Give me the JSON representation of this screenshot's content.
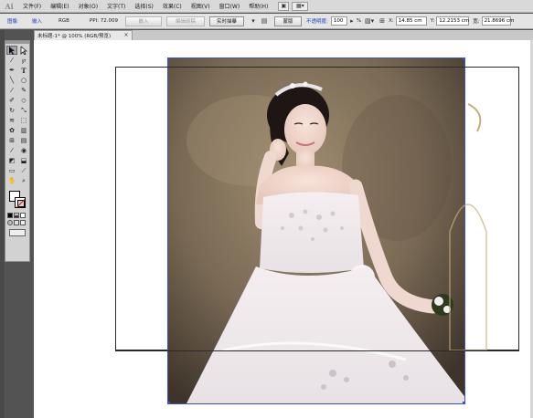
{
  "app": {
    "logo": "Ai"
  },
  "menu": {
    "items": [
      "文件(F)",
      "编辑(E)",
      "对象(O)",
      "文字(T)",
      "选择(S)",
      "效果(C)",
      "视图(V)",
      "窗口(W)",
      "帮助(H)"
    ]
  },
  "control_bar": {
    "image_label": "图像",
    "embed_link": "嵌入",
    "color_mode": "RGB",
    "ppi": "PPI: 72.009",
    "embed_button": "嵌入",
    "edit_original_button": "编辑原稿",
    "live_trace_button": "实时描摹",
    "mask_button": "蒙版",
    "opacity_label": "不透明度:",
    "opacity_value": "100",
    "opacity_unit": "%",
    "x_label": "X:",
    "x_value": "14.85 cm",
    "y_label": "Y:",
    "y_value": "12.2153 cm",
    "w_label": "宽:",
    "w_value": "21.8696 cm"
  },
  "document_tab": {
    "title": "未标题-1* @ 100% (RGB/预览)",
    "close": "×"
  },
  "icons": {
    "menu_bar": [
      "layout-icon",
      "arrange-documents-icon"
    ],
    "tools": [
      "selection-icon",
      "direct-selection-icon",
      "magic-wand-icon",
      "lasso-icon",
      "pen-icon",
      "type-icon",
      "line-segment-icon",
      "ellipse-icon",
      "paintbrush-icon",
      "pencil-icon",
      "blob-brush-icon",
      "eraser-icon",
      "rotate-icon",
      "scale-icon",
      "warp-icon",
      "free-transform-icon",
      "symbol-sprayer-icon",
      "column-graph-icon",
      "mesh-icon",
      "gradient-icon",
      "eyedropper-icon",
      "blend-icon",
      "live-paint-bucket-icon",
      "live-paint-selection-icon",
      "artboard-icon",
      "slice-icon",
      "hand-icon",
      "zoom-icon"
    ]
  }
}
